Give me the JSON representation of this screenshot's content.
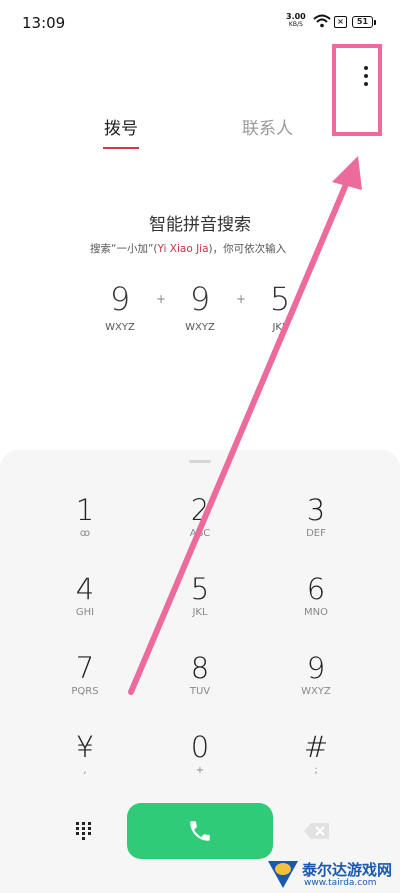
{
  "status": {
    "time": "13:09",
    "net_speed": "3.00",
    "net_unit": "KB/S",
    "sim_label": "×",
    "battery": "51"
  },
  "tabs": [
    {
      "label": "拨号"
    },
    {
      "label": "联系人"
    }
  ],
  "tip": {
    "title": "智能拼音搜索",
    "desc_prefix": "搜索“一小加”(",
    "desc_pinyin": "Yi Xiao Jia",
    "desc_suffix": ")，你可依次输入",
    "sequence": [
      {
        "digit": "9",
        "letters": "WXYZ"
      },
      {
        "digit": "9",
        "letters": "WXYZ"
      },
      {
        "digit": "5",
        "letters": "JKL"
      }
    ],
    "plus": "+"
  },
  "keypad": {
    "keys": [
      {
        "digit": "1",
        "sub": "ꝏ"
      },
      {
        "digit": "2",
        "sub": "ABC"
      },
      {
        "digit": "3",
        "sub": "DEF"
      },
      {
        "digit": "4",
        "sub": "GHI"
      },
      {
        "digit": "5",
        "sub": "JKL"
      },
      {
        "digit": "6",
        "sub": "MNO"
      },
      {
        "digit": "7",
        "sub": "PQRS"
      },
      {
        "digit": "8",
        "sub": "TUV"
      },
      {
        "digit": "9",
        "sub": "WXYZ"
      },
      {
        "digit": "¥",
        "sub": ","
      },
      {
        "digit": "0",
        "sub": "+"
      },
      {
        "digit": "#",
        "sub": ";"
      }
    ]
  },
  "icons": {
    "more": "more-vertical-icon",
    "call": "phone-icon",
    "dialpad": "dialpad-icon",
    "backspace": "backspace-icon"
  },
  "colors": {
    "accent": "#cc3b4a",
    "call_green": "#2fcb78",
    "annotation": "#ee6a9a"
  },
  "watermark": {
    "name": "泰尔达游戏网",
    "url": "www.tairda.com"
  }
}
